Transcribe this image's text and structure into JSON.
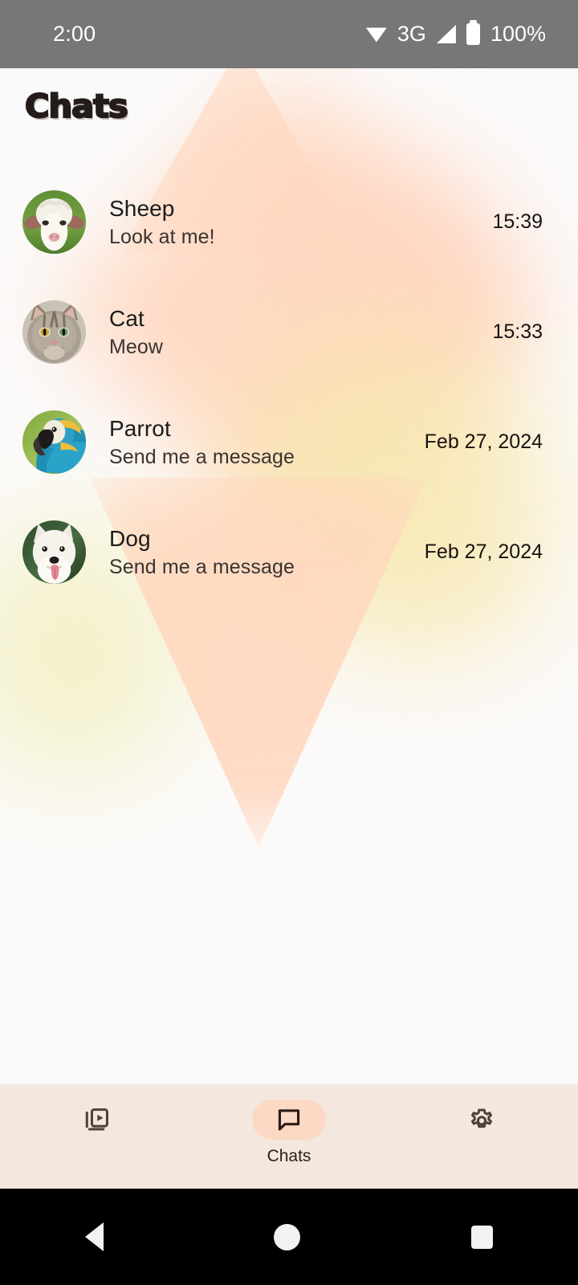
{
  "status_bar": {
    "time": "2:00",
    "network_type": "3G",
    "battery_percent": "100%",
    "icons": [
      "wifi-icon",
      "signal-icon",
      "battery-icon"
    ]
  },
  "header": {
    "title": "Chats"
  },
  "chats": [
    {
      "name": "Sheep",
      "message": "Look at me!",
      "time": "15:39",
      "avatar": "sheep-avatar"
    },
    {
      "name": "Cat",
      "message": "Meow",
      "time": "15:33",
      "avatar": "cat-avatar"
    },
    {
      "name": "Parrot",
      "message": "Send me a message",
      "time": "Feb 27, 2024",
      "avatar": "parrot-avatar"
    },
    {
      "name": "Dog",
      "message": "Send me a message",
      "time": "Feb 27, 2024",
      "avatar": "dog-avatar"
    }
  ],
  "bottom_nav": {
    "items": [
      {
        "label": "",
        "icon": "media-library-icon",
        "active": false
      },
      {
        "label": "Chats",
        "icon": "chat-bubble-icon",
        "active": true
      },
      {
        "label": "",
        "icon": "gear-icon",
        "active": false
      }
    ]
  },
  "system_nav": {
    "back": "back-triangle",
    "home": "home-circle",
    "recents": "recents-square"
  },
  "colors": {
    "status_bar_bg": "#777777",
    "page_bg": "#fbfafa",
    "accent_peach": "#fcd9c4",
    "bottom_nav_bg": "#f4e7dd",
    "icon_dark": "#4e403a",
    "title_color": "#241c19"
  }
}
